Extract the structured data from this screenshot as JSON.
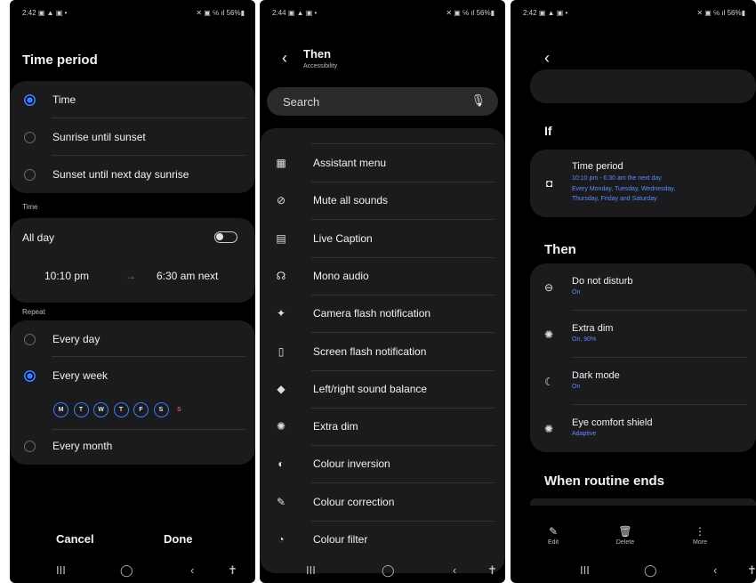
{
  "phone1": {
    "status_time": "2:42",
    "status_left_icons": "▣ ▲ ▣ •",
    "status_right": "✕ ▣ ℅ ıl 56%▮",
    "title": "Time period",
    "options": [
      {
        "label": "Time",
        "selected": true
      },
      {
        "label": "Sunrise until sunset",
        "selected": false
      },
      {
        "label": "Sunset until next day sunrise",
        "selected": false
      }
    ],
    "time_section": "Time",
    "all_day_label": "All day",
    "all_day_on": false,
    "start_time": "10:10  pm",
    "arrow": "→",
    "end_time": "6:30  am next",
    "repeat_section": "Repeat",
    "repeat_options": [
      {
        "label": "Every day",
        "selected": false
      },
      {
        "label": "Every week",
        "selected": true
      },
      {
        "label": "Every month",
        "selected": false
      }
    ],
    "days": [
      "M",
      "T",
      "W",
      "T",
      "F",
      "S"
    ],
    "day_sunday": "S",
    "cancel_label": "Cancel",
    "done_label": "Done"
  },
  "phone2": {
    "status_time": "2:44",
    "status_left_icons": "▣ ▲ ▣ •",
    "status_right": "✕ ▣ ℅ ıl 56%▮",
    "back_icon": "‹",
    "title": "Then",
    "subtitle": "Accessibility",
    "search_placeholder": "Search",
    "items": [
      {
        "icon": "assistant-menu-icon",
        "glyph": "▦",
        "label": "Assistant menu"
      },
      {
        "icon": "mute-icon",
        "glyph": "⊘",
        "label": "Mute all sounds"
      },
      {
        "icon": "caption-icon",
        "glyph": "▤",
        "label": "Live Caption"
      },
      {
        "icon": "mono-audio-icon",
        "glyph": "☊",
        "label": "Mono audio"
      },
      {
        "icon": "camera-flash-icon",
        "glyph": "✦",
        "label": "Camera flash notification"
      },
      {
        "icon": "screen-flash-icon",
        "glyph": "▯",
        "label": "Screen flash notification"
      },
      {
        "icon": "sound-balance-icon",
        "glyph": "◆",
        "label": "Left/right sound balance"
      },
      {
        "icon": "extra-dim-icon",
        "glyph": "✺",
        "label": "Extra dim"
      },
      {
        "icon": "colour-inversion-icon",
        "glyph": "◐",
        "label": "Colour inversion"
      },
      {
        "icon": "colour-correction-icon",
        "glyph": "✎",
        "label": "Colour correction"
      },
      {
        "icon": "colour-filter-icon",
        "glyph": "◔",
        "label": "Colour filter"
      }
    ]
  },
  "phone3": {
    "status_time": "2:42",
    "status_left_icons": "▣ ▲ ▣ •",
    "status_right": "✕ ▣ ℅ ıl 56%▮",
    "back_icon": "‹",
    "if_header": "If",
    "if_title": "Time period",
    "if_line1": "10:10  pm - 6:30  am the next day",
    "if_line2": "Every Monday, Tuesday, Wednesday,",
    "if_line3": "Thursday, Friday and Saturday",
    "then_header": "Then",
    "then_items": [
      {
        "icon": "dnd-icon",
        "glyph": "⊖",
        "title": "Do not disturb",
        "sub": "On"
      },
      {
        "icon": "extra-dim-icon",
        "glyph": "✺",
        "title": "Extra dim",
        "sub": "On, 90%"
      },
      {
        "icon": "dark-mode-icon",
        "glyph": "☾",
        "title": "Dark mode",
        "sub": "On"
      },
      {
        "icon": "eye-comfort-icon",
        "glyph": "✺",
        "title": "Eye comfort shield",
        "sub": "Adaptive"
      }
    ],
    "when_ends": "When routine ends",
    "actions": [
      {
        "icon": "edit-icon",
        "glyph": "✎",
        "label": "Edit"
      },
      {
        "icon": "delete-icon",
        "glyph": "🗑",
        "label": "Delete"
      },
      {
        "icon": "more-icon",
        "glyph": "⋮",
        "label": "More"
      }
    ]
  },
  "navbar": {
    "recents": "III",
    "home": "◯",
    "back": "‹",
    "accessibility": "✝"
  },
  "colors": {
    "accent": "#3a7dff",
    "card": "#1b1b1d",
    "background": "#000000"
  }
}
